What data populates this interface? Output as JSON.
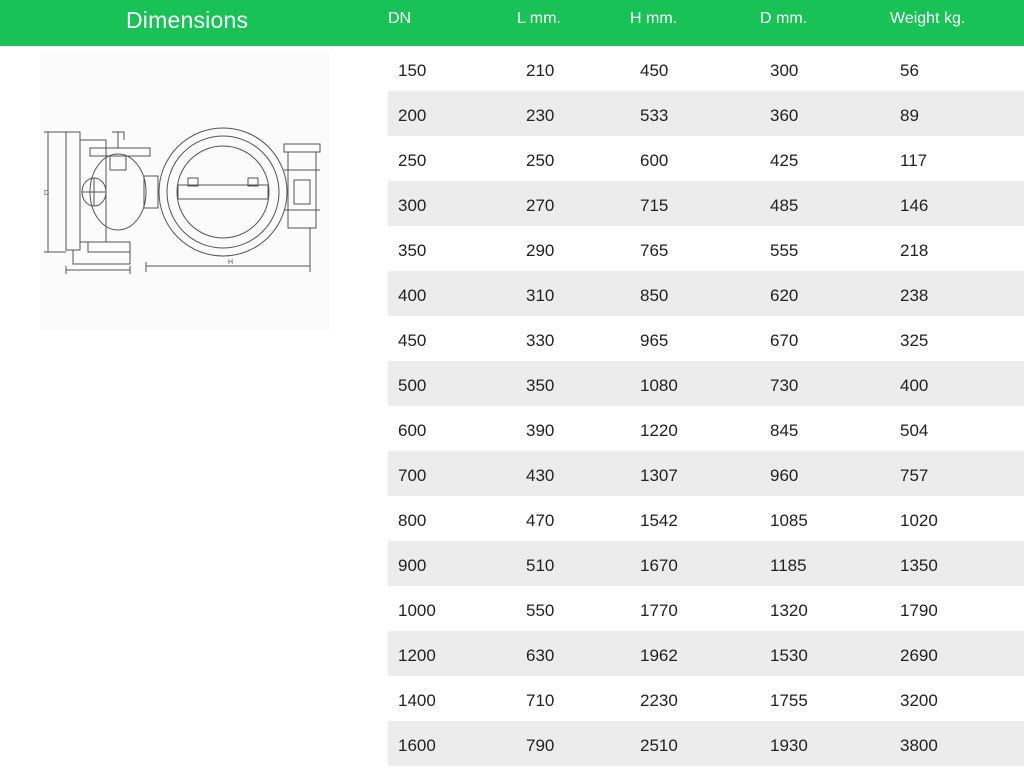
{
  "header": {
    "title": "Dimensions",
    "columns": [
      "DN",
      "L mm.",
      "H mm.",
      "D mm.",
      "Weight kg."
    ]
  },
  "drawing": {
    "labels": {
      "d": "D",
      "h": "H"
    }
  },
  "rows": [
    [
      "150",
      "210",
      "450",
      "300",
      "56"
    ],
    [
      "200",
      "230",
      "533",
      "360",
      "89"
    ],
    [
      "250",
      "250",
      "600",
      "425",
      "117"
    ],
    [
      "300",
      "270",
      "715",
      "485",
      "146"
    ],
    [
      "350",
      "290",
      "765",
      "555",
      "218"
    ],
    [
      "400",
      "310",
      "850",
      "620",
      "238"
    ],
    [
      "450",
      "330",
      "965",
      "670",
      "325"
    ],
    [
      "500",
      "350",
      "1080",
      "730",
      "400"
    ],
    [
      "600",
      "390",
      "1220",
      "845",
      "504"
    ],
    [
      "700",
      "430",
      "1307",
      "960",
      "757"
    ],
    [
      "800",
      "470",
      "1542",
      "1085",
      "1020"
    ],
    [
      "900",
      "510",
      "1670",
      "1185",
      "1350"
    ],
    [
      "1000",
      "550",
      "1770",
      "1320",
      "1790"
    ],
    [
      "1200",
      "630",
      "1962",
      "1530",
      "2690"
    ],
    [
      "1400",
      "710",
      "2230",
      "1755",
      "3200"
    ],
    [
      "1600",
      "790",
      "2510",
      "1930",
      "3800"
    ]
  ],
  "colors": {
    "header": "#18c256",
    "row_alt": "#ececec",
    "text": "#222222"
  }
}
